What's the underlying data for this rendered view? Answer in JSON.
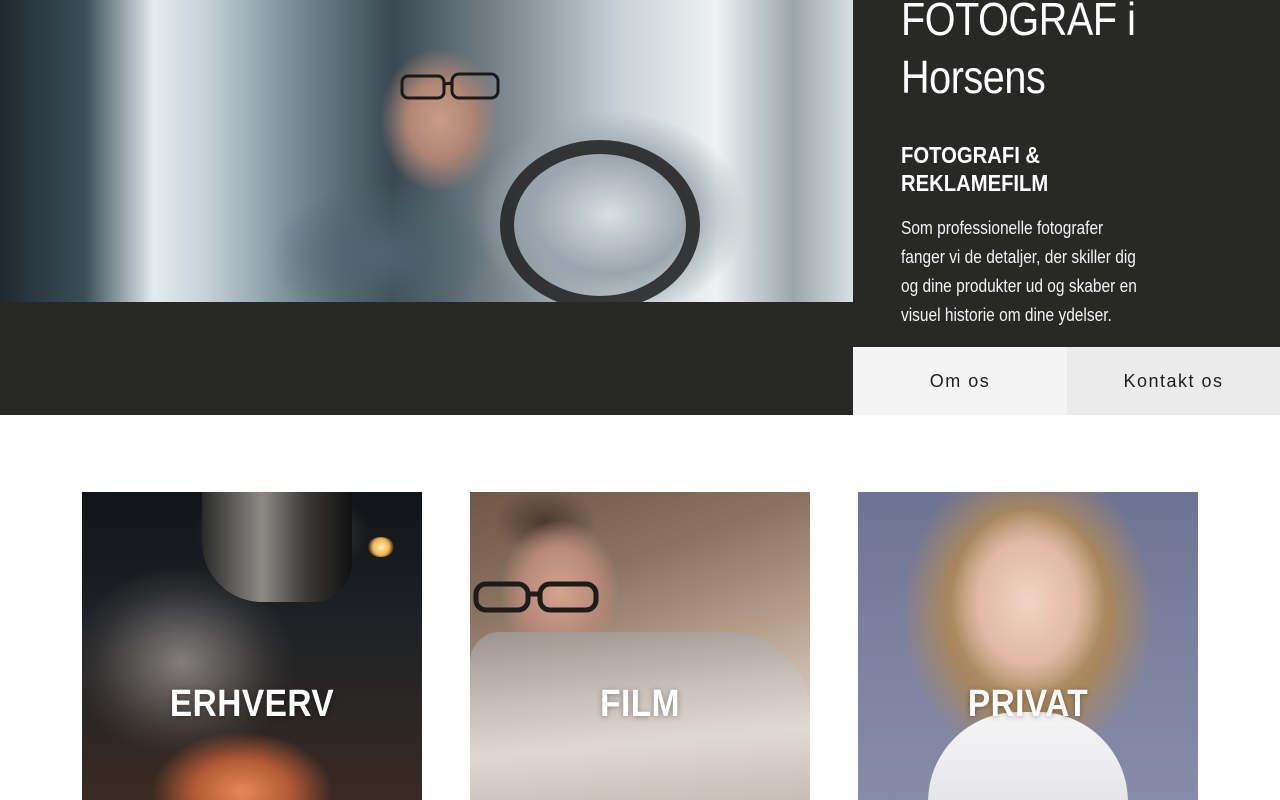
{
  "hero": {
    "title_line1": "FOTOGRAF i",
    "title_line2": "Horsens",
    "subtitle_line1": "FOTOGRAFI &",
    "subtitle_line2": "REKLAMEFILM",
    "description": "Som professionelle fotografer fanger vi de detaljer, der skiller dig og dine produkter ud og skaber en visuel historie om dine ydelser.",
    "buttons": {
      "about": "Om os",
      "contact": "Kontakt os"
    }
  },
  "categories": [
    {
      "label": "ERHVERV"
    },
    {
      "label": "FILM"
    },
    {
      "label": "PRIVAT"
    }
  ],
  "colors": {
    "hero_background": "#282827",
    "button_light": "#f4f4f4",
    "button_lighter": "#ebebeb",
    "text_on_dark": "#ffffff"
  }
}
